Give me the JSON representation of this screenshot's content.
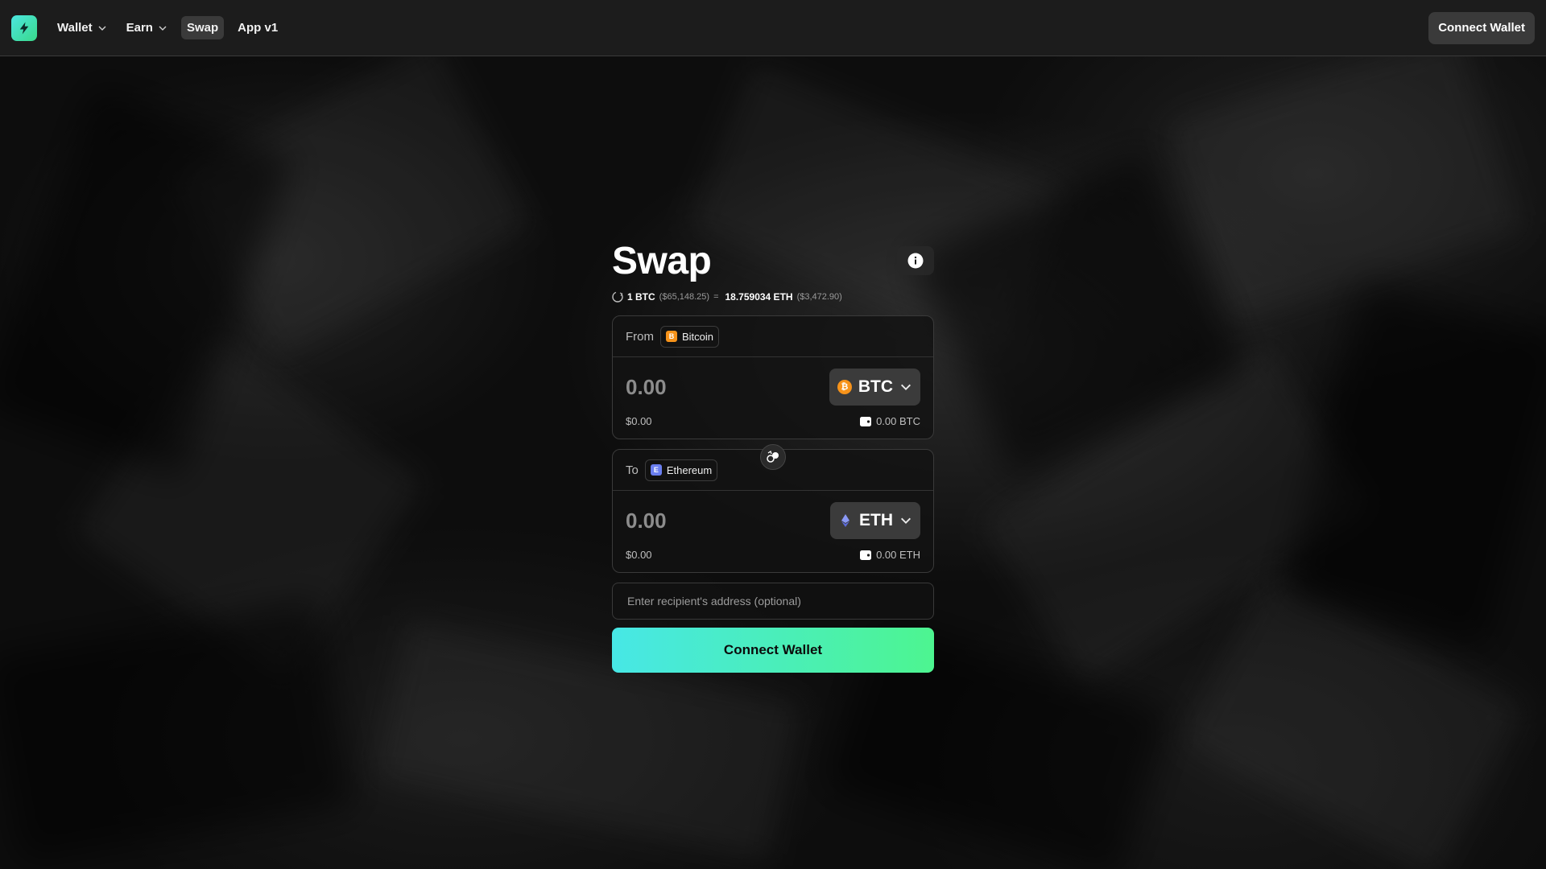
{
  "nav": {
    "items": [
      {
        "label": "Wallet",
        "has_dropdown": true
      },
      {
        "label": "Earn",
        "has_dropdown": true
      },
      {
        "label": "Swap",
        "active": true
      },
      {
        "label": "App v1"
      }
    ],
    "connect_label": "Connect Wallet"
  },
  "swap": {
    "title": "Swap",
    "rate": {
      "base_amount": "1 BTC",
      "base_usd": "($65,148.25)",
      "equals": "=",
      "quote_amount": "18.759034 ETH",
      "quote_usd": "($3,472.90)"
    },
    "from": {
      "label": "From",
      "chain": "Bitcoin",
      "chain_icon": "B",
      "amount_placeholder": "0.00",
      "token": "BTC",
      "usd_value": "$0.00",
      "balance": "0.00 BTC"
    },
    "to": {
      "label": "To",
      "chain": "Ethereum",
      "chain_icon": "E",
      "amount_placeholder": "0.00",
      "token": "ETH",
      "usd_value": "$0.00",
      "balance": "0.00 ETH"
    },
    "recipient_placeholder": "Enter recipient's address (optional)",
    "connect_label": "Connect Wallet"
  },
  "colors": {
    "btc": "#f7931a",
    "eth": "#6b7ff0",
    "accent_start": "#47e7e6",
    "accent_end": "#4df590"
  }
}
